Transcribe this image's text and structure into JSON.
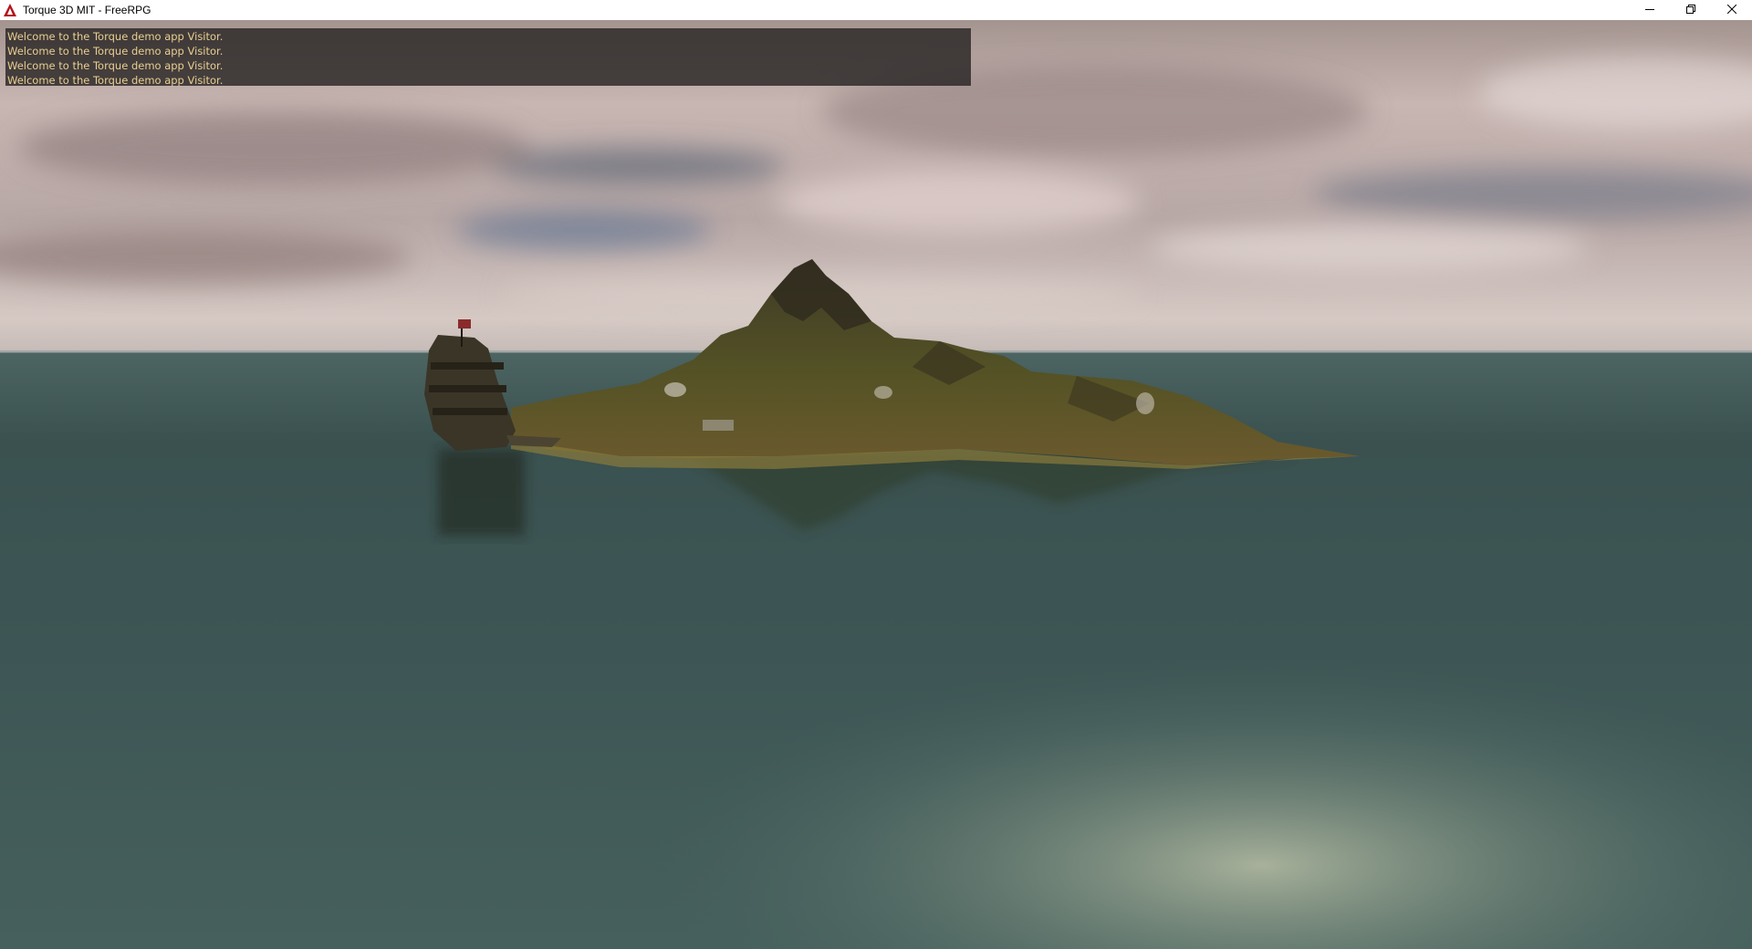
{
  "window": {
    "title": "Torque 3D MIT - FreeRPG",
    "app_icon": "torque-logo-icon",
    "controls": {
      "minimize_icon": "minimize-icon",
      "restore_icon": "restore-icon",
      "close_icon": "close-icon"
    }
  },
  "hud": {
    "chat_lines": [
      "Welcome to the Torque demo app Visitor.",
      "Welcome to the Torque demo app Visitor.",
      "Welcome to the Torque demo app Visitor.",
      "Welcome to the Torque demo app Visitor."
    ],
    "text_color": "#e8cf90"
  },
  "scene": {
    "elements": [
      "sky",
      "ocean",
      "island",
      "ship",
      "flag"
    ],
    "colors": {
      "sky_top": "#c9b7b4",
      "horizon": "#d9cec8",
      "ocean": "#3f5a58",
      "island": "#4a4a24"
    }
  }
}
